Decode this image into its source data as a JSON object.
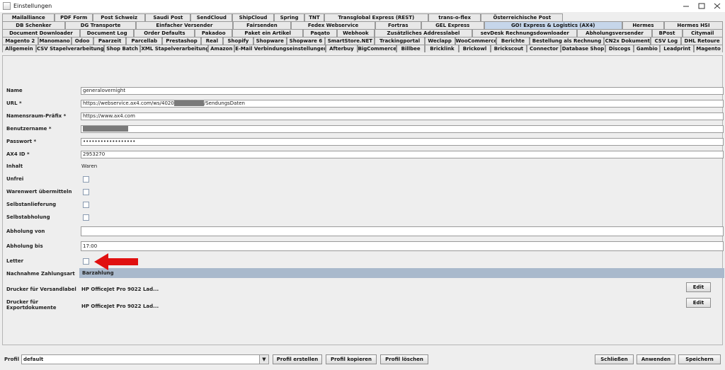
{
  "window": {
    "title": "Einstellungen"
  },
  "tab_rows": [
    [
      "Mailalliance",
      "PDF Form",
      "Post Schweiz",
      "Saudi Post",
      "SendCloud",
      "ShipCloud",
      "Spring",
      "TNT",
      "Transglobal Express (REST)",
      "trans-o-flex",
      "Österreichische Post"
    ],
    [
      "DB Schenker",
      "DG Transporte",
      "Einfacher Versender",
      "Fairsenden",
      "Fedex Webservice",
      "Fortras",
      "GEL Express",
      "GO! Express & Logistics (AX4)",
      "Hermes",
      "Hermes HSI"
    ],
    [
      "Document Downloader",
      "Document Log",
      "Order Defaults",
      "Pakadoo",
      "Paket ein Artikel",
      "Paqato",
      "Webhook",
      "Zusätzliches Addresslabel",
      "sevDesk Rechnungsdownloader",
      "Abholungsversender",
      "BPost",
      "Citymail"
    ],
    [
      "Magento 2",
      "Manomano",
      "Odoo",
      "Paarzeit",
      "Parcellab",
      "Prestashop",
      "Real",
      "Shopify",
      "Shopware",
      "Shopware 6",
      "SmartStore.NET",
      "Trackingportal",
      "Weclapp",
      "WooCommerce",
      "Berichte",
      "Bestellung als Rechnung",
      "CN2x Dokument",
      "CSV Log",
      "DHL Retoure"
    ],
    [
      "Allgemein",
      "CSV Stapelverarbeitung",
      "Shop Batch",
      "XML Stapelverarbeitung",
      "Amazon",
      "E-Mail Verbindungseinstellungen",
      "Afterbuy",
      "BigCommerce",
      "Billbee",
      "Bricklink",
      "Brickowl",
      "Brickscout",
      "Connector",
      "Database Shop",
      "Discogs",
      "Gambio",
      "Leadprint",
      "Magento"
    ]
  ],
  "active_tab": "GO! Express & Logistics (AX4)",
  "form": {
    "name_label": "Name",
    "name_value": "generalovernight",
    "url_label": "URL *",
    "url_value_prefix": "https://webservice.ax4.com/ws/4020",
    "url_value_suffix": "/SendungsDaten",
    "ns_label": "Namensraum-Präfix *",
    "ns_value": "https://www.ax4.com",
    "user_label": "Benutzername *",
    "pass_label": "Passwort *",
    "pass_value": "••••••••••••••••••",
    "ax4id_label": "AX4 ID *",
    "ax4id_value": "2953270",
    "inhalt_label": "Inhalt",
    "inhalt_value": "Waren",
    "unfrei_label": "Unfrei",
    "warenwert_label": "Warenwert übermitteln",
    "selbstanlieferung_label": "Selbstanlieferung",
    "selbstabholung_label": "Selbstabholung",
    "abholung_von_label": "Abholung von",
    "abholung_von_value": "",
    "abholung_bis_label": "Abholung bis",
    "abholung_bis_value": "17:00",
    "letter_label": "Letter",
    "nachnahme_label": "Nachnahme Zahlungsart",
    "nachnahme_value": "Barzahlung",
    "drucker_versand_label": "Drucker für Versandlabel",
    "drucker_versand_value": "HP OfficeJet Pro 9022 Lad...",
    "drucker_export_label_1": "Drucker für",
    "drucker_export_label_2": "Exportdokumente",
    "drucker_export_value": "HP OfficeJet Pro 9022 Lad...",
    "edit_label": "Edit"
  },
  "footer": {
    "profil_label": "Profil",
    "profil_value": "default",
    "profil_erstellen": "Profil erstellen",
    "profil_kopieren": "Profil kopieren",
    "profil_loeschen": "Profil löschen",
    "schliessen": "Schließen",
    "anwenden": "Anwenden",
    "speichern": "Speichern"
  },
  "colors": {
    "active_tab": "#c6d6ea",
    "selection_bar": "#a9b9cc",
    "arrow": "#e01010"
  }
}
